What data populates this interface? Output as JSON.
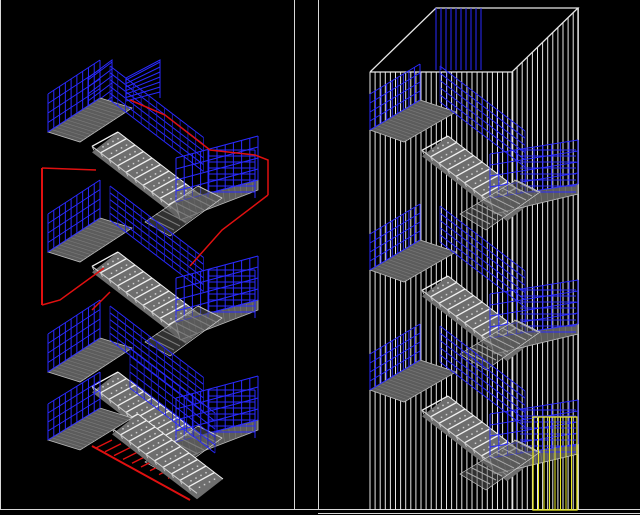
{
  "drawing": {
    "background": "#000000",
    "colors": {
      "frame": "#d8d8d8",
      "stair_fill": "#6e6e6e",
      "landing_fill": "#5c5c5c",
      "tread_edge": "#f0f0f0",
      "railing_blue": "#2a2aff",
      "railing_dark_blue": "#1c1cc8",
      "section_red": "#e01010",
      "column_white": "#e6e6e6",
      "highlight_yellow": "#e8e820"
    },
    "views": [
      {
        "id": "left-view",
        "flights": 6,
        "landings": 4,
        "has_red_section": true
      },
      {
        "id": "right-view",
        "flights": 6,
        "landings": 4,
        "has_enclosure": true,
        "has_yellow_panel": true
      }
    ]
  }
}
